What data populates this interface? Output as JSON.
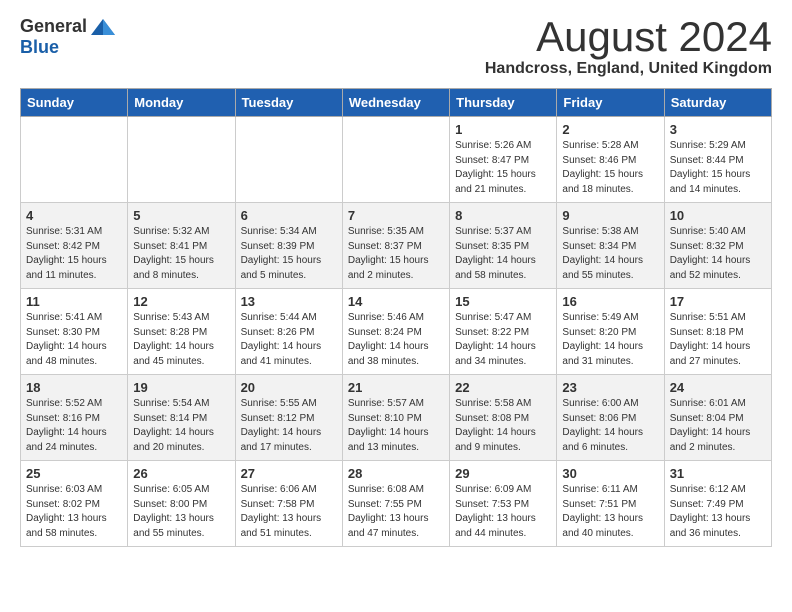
{
  "header": {
    "logo_general": "General",
    "logo_blue": "Blue",
    "month_title": "August 2024",
    "location": "Handcross, England, United Kingdom"
  },
  "weekdays": [
    "Sunday",
    "Monday",
    "Tuesday",
    "Wednesday",
    "Thursday",
    "Friday",
    "Saturday"
  ],
  "weeks": [
    [
      {
        "day": "",
        "info": ""
      },
      {
        "day": "",
        "info": ""
      },
      {
        "day": "",
        "info": ""
      },
      {
        "day": "",
        "info": ""
      },
      {
        "day": "1",
        "info": "Sunrise: 5:26 AM\nSunset: 8:47 PM\nDaylight: 15 hours\nand 21 minutes."
      },
      {
        "day": "2",
        "info": "Sunrise: 5:28 AM\nSunset: 8:46 PM\nDaylight: 15 hours\nand 18 minutes."
      },
      {
        "day": "3",
        "info": "Sunrise: 5:29 AM\nSunset: 8:44 PM\nDaylight: 15 hours\nand 14 minutes."
      }
    ],
    [
      {
        "day": "4",
        "info": "Sunrise: 5:31 AM\nSunset: 8:42 PM\nDaylight: 15 hours\nand 11 minutes."
      },
      {
        "day": "5",
        "info": "Sunrise: 5:32 AM\nSunset: 8:41 PM\nDaylight: 15 hours\nand 8 minutes."
      },
      {
        "day": "6",
        "info": "Sunrise: 5:34 AM\nSunset: 8:39 PM\nDaylight: 15 hours\nand 5 minutes."
      },
      {
        "day": "7",
        "info": "Sunrise: 5:35 AM\nSunset: 8:37 PM\nDaylight: 15 hours\nand 2 minutes."
      },
      {
        "day": "8",
        "info": "Sunrise: 5:37 AM\nSunset: 8:35 PM\nDaylight: 14 hours\nand 58 minutes."
      },
      {
        "day": "9",
        "info": "Sunrise: 5:38 AM\nSunset: 8:34 PM\nDaylight: 14 hours\nand 55 minutes."
      },
      {
        "day": "10",
        "info": "Sunrise: 5:40 AM\nSunset: 8:32 PM\nDaylight: 14 hours\nand 52 minutes."
      }
    ],
    [
      {
        "day": "11",
        "info": "Sunrise: 5:41 AM\nSunset: 8:30 PM\nDaylight: 14 hours\nand 48 minutes."
      },
      {
        "day": "12",
        "info": "Sunrise: 5:43 AM\nSunset: 8:28 PM\nDaylight: 14 hours\nand 45 minutes."
      },
      {
        "day": "13",
        "info": "Sunrise: 5:44 AM\nSunset: 8:26 PM\nDaylight: 14 hours\nand 41 minutes."
      },
      {
        "day": "14",
        "info": "Sunrise: 5:46 AM\nSunset: 8:24 PM\nDaylight: 14 hours\nand 38 minutes."
      },
      {
        "day": "15",
        "info": "Sunrise: 5:47 AM\nSunset: 8:22 PM\nDaylight: 14 hours\nand 34 minutes."
      },
      {
        "day": "16",
        "info": "Sunrise: 5:49 AM\nSunset: 8:20 PM\nDaylight: 14 hours\nand 31 minutes."
      },
      {
        "day": "17",
        "info": "Sunrise: 5:51 AM\nSunset: 8:18 PM\nDaylight: 14 hours\nand 27 minutes."
      }
    ],
    [
      {
        "day": "18",
        "info": "Sunrise: 5:52 AM\nSunset: 8:16 PM\nDaylight: 14 hours\nand 24 minutes."
      },
      {
        "day": "19",
        "info": "Sunrise: 5:54 AM\nSunset: 8:14 PM\nDaylight: 14 hours\nand 20 minutes."
      },
      {
        "day": "20",
        "info": "Sunrise: 5:55 AM\nSunset: 8:12 PM\nDaylight: 14 hours\nand 17 minutes."
      },
      {
        "day": "21",
        "info": "Sunrise: 5:57 AM\nSunset: 8:10 PM\nDaylight: 14 hours\nand 13 minutes."
      },
      {
        "day": "22",
        "info": "Sunrise: 5:58 AM\nSunset: 8:08 PM\nDaylight: 14 hours\nand 9 minutes."
      },
      {
        "day": "23",
        "info": "Sunrise: 6:00 AM\nSunset: 8:06 PM\nDaylight: 14 hours\nand 6 minutes."
      },
      {
        "day": "24",
        "info": "Sunrise: 6:01 AM\nSunset: 8:04 PM\nDaylight: 14 hours\nand 2 minutes."
      }
    ],
    [
      {
        "day": "25",
        "info": "Sunrise: 6:03 AM\nSunset: 8:02 PM\nDaylight: 13 hours\nand 58 minutes."
      },
      {
        "day": "26",
        "info": "Sunrise: 6:05 AM\nSunset: 8:00 PM\nDaylight: 13 hours\nand 55 minutes."
      },
      {
        "day": "27",
        "info": "Sunrise: 6:06 AM\nSunset: 7:58 PM\nDaylight: 13 hours\nand 51 minutes."
      },
      {
        "day": "28",
        "info": "Sunrise: 6:08 AM\nSunset: 7:55 PM\nDaylight: 13 hours\nand 47 minutes."
      },
      {
        "day": "29",
        "info": "Sunrise: 6:09 AM\nSunset: 7:53 PM\nDaylight: 13 hours\nand 44 minutes."
      },
      {
        "day": "30",
        "info": "Sunrise: 6:11 AM\nSunset: 7:51 PM\nDaylight: 13 hours\nand 40 minutes."
      },
      {
        "day": "31",
        "info": "Sunrise: 6:12 AM\nSunset: 7:49 PM\nDaylight: 13 hours\nand 36 minutes."
      }
    ]
  ]
}
